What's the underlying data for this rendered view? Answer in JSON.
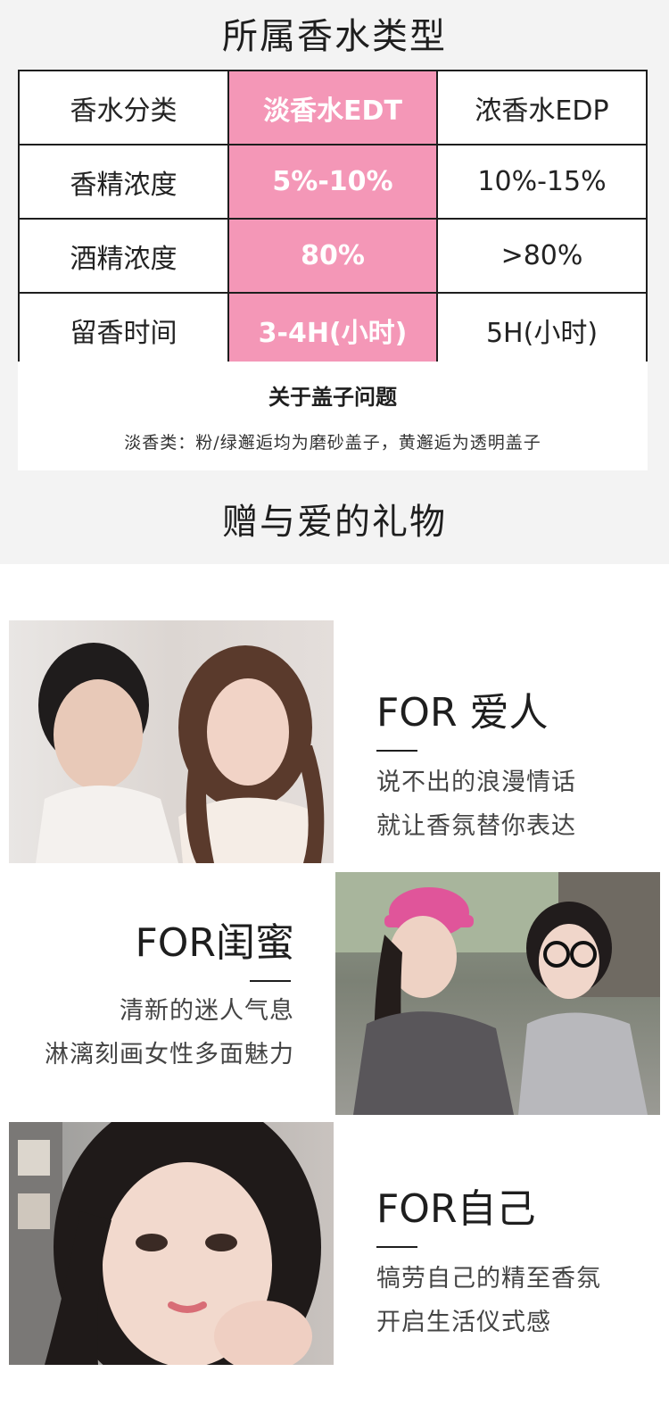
{
  "section_type": {
    "title": "所属香水类型",
    "rows": [
      {
        "label": "香水分类",
        "edt": "淡香水EDT",
        "edp": "浓香水EDP"
      },
      {
        "label": "香精浓度",
        "edt": "5%-10%",
        "edp": "10%-15%"
      },
      {
        "label": "酒精浓度",
        "edt": "80%",
        "edp": ">80%"
      },
      {
        "label": "留香时间",
        "edt": "3-4H(小时)",
        "edp": "5H(小时)"
      }
    ],
    "highlight_color": "#f497b7"
  },
  "cap_note": {
    "title": "关于盖子问题",
    "text": "淡香类：粉/绿邂逅均为磨砂盖子，黄邂逅为透明盖子"
  },
  "section_gift": {
    "title": "赠与爱的礼物",
    "items": [
      {
        "title": "FOR 爱人",
        "lines": [
          "说不出的浪漫情话",
          "就让香氛替你表达"
        ]
      },
      {
        "title": "FOR闺蜜",
        "lines": [
          "清新的迷人气息",
          "淋漓刻画女性多面魅力"
        ]
      },
      {
        "title": "FOR自己",
        "lines": [
          "犒劳自己的精至香氛",
          "开启生活仪式感"
        ]
      }
    ]
  }
}
